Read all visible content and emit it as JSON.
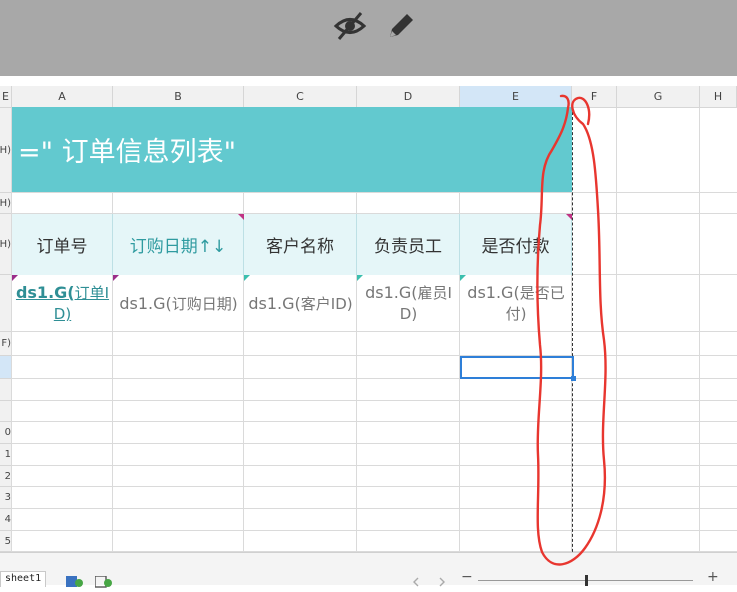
{
  "toolbar": {
    "icons": [
      "eye-slash-icon",
      "pencil-icon"
    ]
  },
  "columns": [
    {
      "label": "E",
      "w": 12
    },
    {
      "label": "A",
      "w": 101
    },
    {
      "label": "B",
      "w": 131
    },
    {
      "label": "C",
      "w": 113
    },
    {
      "label": "D",
      "w": 103
    },
    {
      "label": "E",
      "w": 112,
      "selected": true
    },
    {
      "label": "F",
      "w": 45
    },
    {
      "label": "G",
      "w": 83
    },
    {
      "label": "H",
      "w": 37
    }
  ],
  "row_headers": [
    "H)",
    "H)",
    "H)",
    "",
    "F)",
    "",
    "",
    "",
    "0",
    "1",
    "2",
    "3",
    "4",
    "5"
  ],
  "report": {
    "title": "=\" 订单信息列表\"",
    "headers": [
      "订单号",
      "订购日期↑↓",
      "客户名称",
      "负责员工",
      "是否付款"
    ],
    "data": [
      {
        "prefix": "ds1.G(",
        "field": "订单ID)"
      },
      {
        "prefix": "ds1.G(",
        "field": "订购日期)"
      },
      {
        "prefix": "ds1.G(",
        "field": "客户ID)"
      },
      {
        "prefix": "ds1.G(",
        "field": "雇员ID)"
      },
      {
        "prefix": "ds1.G(",
        "field": "是否已付)"
      }
    ]
  },
  "bottom": {
    "sheet_name": "sheet1",
    "zoom_minus": "−",
    "zoom_plus": "+"
  },
  "colors": {
    "title_bg": "#62c9cf",
    "header_bg": "#e5f6f8",
    "accent": "#2f9ba0",
    "selection": "#2e7fd8",
    "annotation": "#e8362f"
  }
}
